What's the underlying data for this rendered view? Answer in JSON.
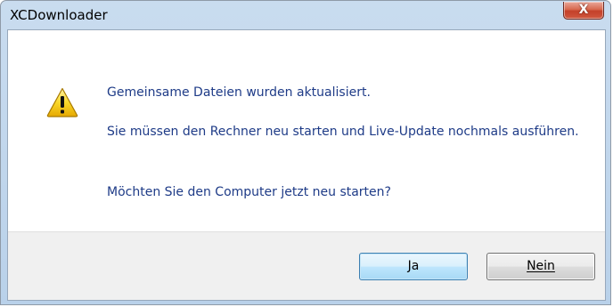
{
  "window": {
    "title": "XCDownloader",
    "close_label": "X"
  },
  "icon": "warning-icon",
  "message": {
    "line1": "Gemeinsame Dateien wurden aktualisiert.",
    "line2": "Sie müssen den Rechner neu starten und Live-Update nochmals ausführen.",
    "line3": "Möchten Sie den Computer jetzt neu starten?"
  },
  "buttons": {
    "yes_label": "Ja",
    "no_label": "Nein"
  },
  "colors": {
    "message_text": "#1e3b87",
    "frame": "#b9d1ea",
    "close_button": "#c4402a",
    "warning_yellow": "#f5c500"
  }
}
